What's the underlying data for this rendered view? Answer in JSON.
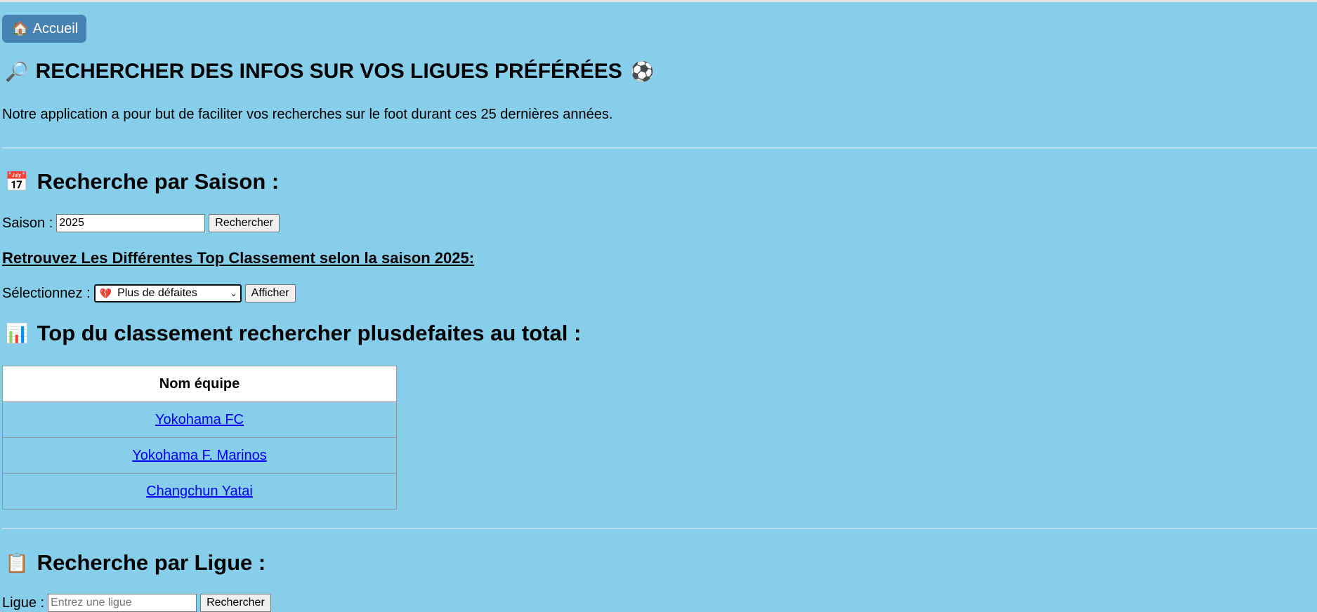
{
  "nav": {
    "home_icon": "house-icon",
    "home_emoji": "🏠",
    "home_label": "Accueil",
    "home_bg": "#4682b4"
  },
  "header": {
    "lead_emoji": "🔎",
    "title": "RECHERCHER DES INFOS SUR VOS LIGUES PRÉFÉRÉES",
    "trail_emoji": "⚽",
    "intro": "Notre application a pour but de faciliter vos recherches sur le foot durant ces 25 dernières années."
  },
  "season_section": {
    "emoji": "📅",
    "title": "Recherche par Saison :",
    "label": "Saison :",
    "input_value": "2025",
    "search_label": "Rechercher",
    "top_heading": "Retrouvez Les Différentes Top Classement selon la saison 2025:",
    "select_label": "Sélectionnez :",
    "select_icon": "broken-heart-icon",
    "select_emoji": "💔",
    "select_value": "Plus de défaites",
    "show_label": "Afficher"
  },
  "ranking": {
    "emoji": "📊",
    "title": "Top du classement rechercher plusdefaites au total :",
    "column_header": "Nom équipe",
    "rows": [
      {
        "team": "Yokohama FC"
      },
      {
        "team": "Yokohama F. Marinos"
      },
      {
        "team": "Changchun Yatai"
      }
    ]
  },
  "league_section": {
    "emoji": "📋",
    "title": "Recherche par Ligue :",
    "label": "Ligue :",
    "input_placeholder": "Entrez une ligue",
    "search_label": "Rechercher"
  },
  "colors": {
    "page_background": "#87ceeb",
    "link": "#0000ee"
  }
}
